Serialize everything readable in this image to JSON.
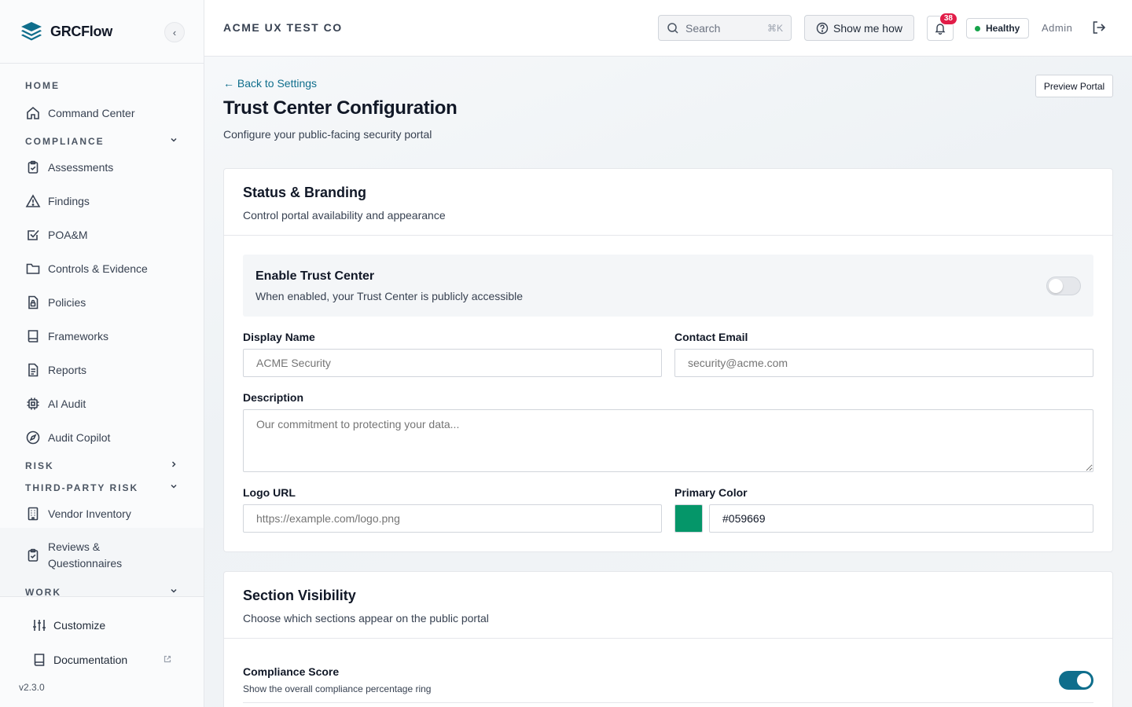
{
  "brand": {
    "name": "GRCFlow",
    "collapse_icon": "‹"
  },
  "nav": {
    "sections": {
      "home": "HOME",
      "compliance": "COMPLIANCE",
      "risk": "RISK",
      "third_party": "THIRD-PARTY RISK",
      "work": "WORK"
    },
    "items": {
      "command_center": "Command Center",
      "assessments": "Assessments",
      "findings": "Findings",
      "poam": "POA&M",
      "controls": "Controls & Evidence",
      "policies": "Policies",
      "frameworks": "Frameworks",
      "reports": "Reports",
      "ai_audit": "AI Audit",
      "audit_copilot": "Audit Copilot",
      "vendor_inventory": "Vendor Inventory",
      "reviews_line1": "Reviews &",
      "reviews_line2": "Questionnaires"
    }
  },
  "footer": {
    "customize": "Customize",
    "documentation": "Documentation",
    "version": "v2.3.0"
  },
  "topbar": {
    "org": "ACME UX TEST CO",
    "search_label": "Search",
    "search_shortcut": "⌘K",
    "show_me_how": "Show me how",
    "notification_count": "38",
    "health": "Healthy",
    "user": "Admin"
  },
  "page": {
    "back_link": "← Back to Settings",
    "title": "Trust Center Configuration",
    "subtitle": "Configure your public-facing security portal",
    "preview_button": "Preview Portal"
  },
  "status_card": {
    "title": "Status & Branding",
    "subtitle": "Control portal availability and appearance",
    "enable_title": "Enable Trust Center",
    "enable_desc": "When enabled, your Trust Center is publicly accessible",
    "enabled": false,
    "display_name_label": "Display Name",
    "display_name_placeholder": "ACME Security",
    "contact_email_label": "Contact Email",
    "contact_email_placeholder": "security@acme.com",
    "description_label": "Description",
    "description_placeholder": "Our commitment to protecting your data...",
    "logo_url_label": "Logo URL",
    "logo_url_placeholder": "https://example.com/logo.png",
    "primary_color_label": "Primary Color",
    "primary_color_value": "#059669"
  },
  "visibility_card": {
    "title": "Section Visibility",
    "subtitle": "Choose which sections appear on the public portal",
    "rows": [
      {
        "title": "Compliance Score",
        "desc": "Show the overall compliance percentage ring",
        "enabled": true
      }
    ]
  },
  "colors": {
    "accent": "#0f6e8c",
    "health_dot": "#16a34a",
    "badge": "#e11d48",
    "primary_swatch": "#059669"
  }
}
